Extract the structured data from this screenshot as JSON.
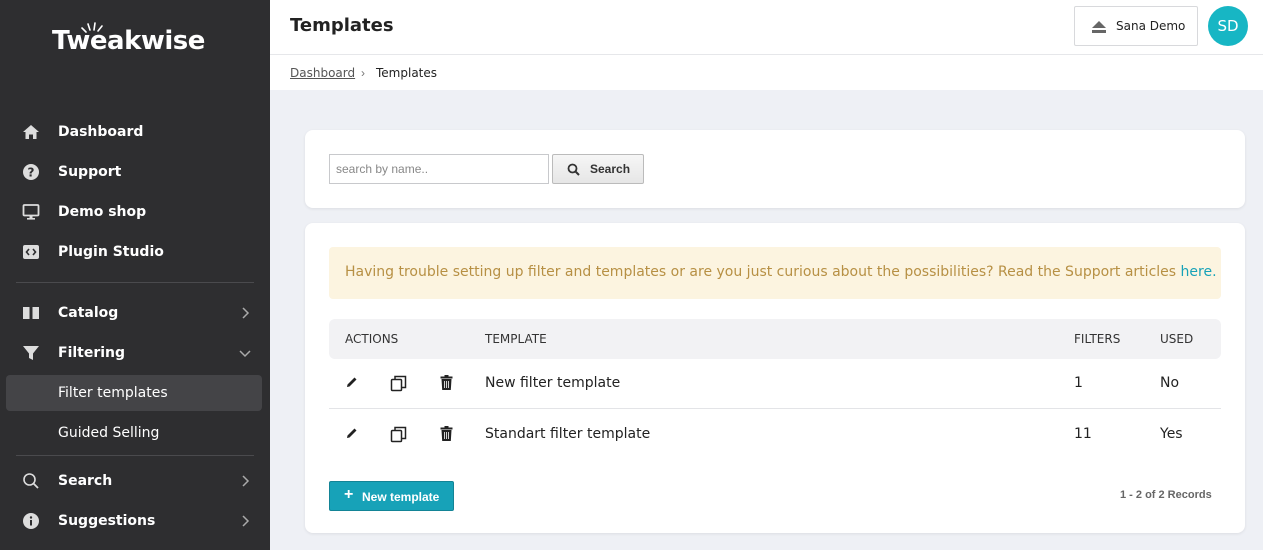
{
  "brand": {
    "logo_text": "Tweakwise",
    "accent": "#17b6c4"
  },
  "sidebar": {
    "items": [
      {
        "label": "Dashboard",
        "icon": "home-icon"
      },
      {
        "label": "Support",
        "icon": "question-circle-icon"
      },
      {
        "label": "Demo shop",
        "icon": "monitor-icon"
      },
      {
        "label": "Plugin Studio",
        "icon": "code-icon"
      },
      {
        "label": "Catalog",
        "icon": "book-icon"
      },
      {
        "label": "Filtering",
        "icon": "funnel-icon"
      },
      {
        "label": "Filter templates"
      },
      {
        "label": "Guided Selling"
      },
      {
        "label": "Search",
        "icon": "search-icon"
      },
      {
        "label": "Suggestions",
        "icon": "info-circle-icon"
      }
    ]
  },
  "header": {
    "title": "Templates",
    "shop_label": "Sana Demo",
    "avatar_initials": "SD"
  },
  "breadcrumb": {
    "link": "Dashboard",
    "separator": "›",
    "current": "Templates"
  },
  "search": {
    "placeholder": "search by name..",
    "value": "",
    "button_label": "Search"
  },
  "notice": {
    "text": "Having trouble setting up filter and templates or are you just curious about the possibilities? Read the Support articles ",
    "link_text": "here."
  },
  "table": {
    "headers": {
      "actions": "ACTIONS",
      "template": "TEMPLATE",
      "filters": "FILTERS",
      "used": "USED"
    },
    "rows": [
      {
        "template": "New filter template",
        "filters": "1",
        "used": "No"
      },
      {
        "template": "Standart filter template",
        "filters": "11",
        "used": "Yes"
      }
    ]
  },
  "footer": {
    "new_button_label": "New template",
    "records": "1 - 2 of 2 Records"
  }
}
